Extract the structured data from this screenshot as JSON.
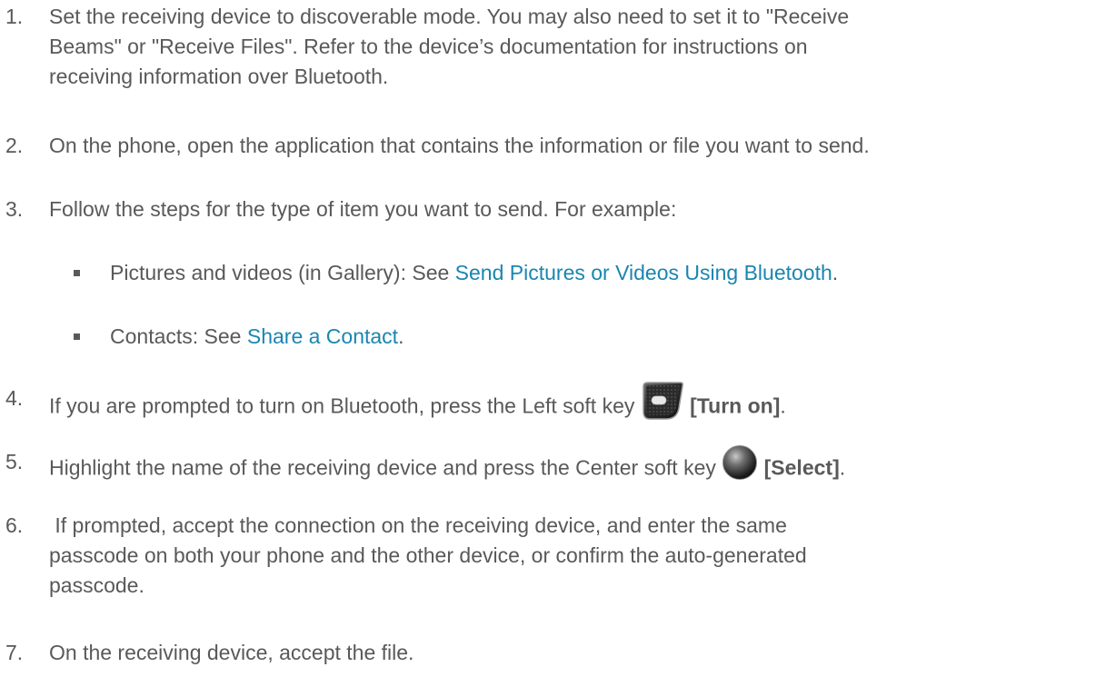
{
  "steps": [
    {
      "num": "1.",
      "lines": [
        "Set the receiving device to discoverable mode. You may also need to set it to \"Receive",
        "Beams\" or \"Receive Files\". Refer to the device’s documentation for instructions on",
        "receiving information over Bluetooth."
      ]
    },
    {
      "num": "2.",
      "text": "On the phone, open the application that contains the information or file you want to send."
    },
    {
      "num": "3.",
      "text": "Follow the steps for the type of item you want to send. For example:"
    },
    {
      "num": "4.",
      "text_before": "If you are prompted to turn on Bluetooth, press the Left soft key",
      "key_label": "[Turn on]",
      "text_after": ".",
      "icon": "left-soft-key-icon"
    },
    {
      "num": "5.",
      "text_before": "Highlight the name of the receiving device and press the Center soft key",
      "key_label": "[Select]",
      "text_after": ".",
      "icon": "center-soft-key-icon"
    },
    {
      "num": "6.",
      "lines": [
        " If prompted, accept the connection on the receiving device, and enter the same",
        "passcode on both your phone and the other device, or confirm the auto-generated",
        "passcode."
      ]
    },
    {
      "num": "7.",
      "text": "On the receiving device, accept the file."
    }
  ],
  "bullets": [
    {
      "prefix": "Pictures and videos (in Gallery): See ",
      "link": "Send Pictures or Videos Using Bluetooth",
      "suffix": "."
    },
    {
      "prefix": "Contacts: See ",
      "link": "Share a Contact",
      "suffix": "."
    }
  ],
  "colors": {
    "text": "#595959",
    "link": "#1a86b0"
  }
}
